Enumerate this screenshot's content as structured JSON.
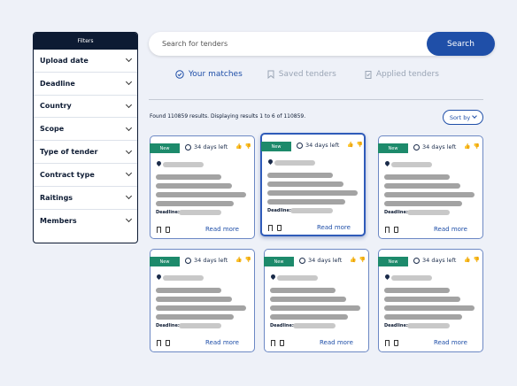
{
  "filters": {
    "title": "Filters",
    "items": [
      "Upload date",
      "Deadline",
      "Country",
      "Scope",
      "Type of tender",
      "Contract type",
      "Raitings",
      "Members"
    ]
  },
  "search": {
    "placeholder": "Search for tenders",
    "button": "Search"
  },
  "tabs": [
    "Your matches",
    "Saved tenders",
    "Applied tenders"
  ],
  "results_text": "Found 110859 results. Displaying results 1 to 6 of 110859.",
  "sort_label": "Sort by",
  "card_common": {
    "badge": "New",
    "days_left": "34 days left",
    "deadline_label": "Deadline:",
    "read_more": "Read more"
  },
  "colors": {
    "navy": "#0d1b33",
    "accent": "#1f4fa8",
    "new_badge": "#1d8a6b"
  }
}
